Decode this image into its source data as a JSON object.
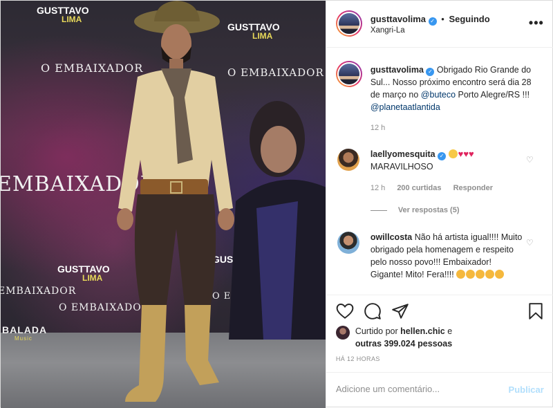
{
  "photo": {
    "alt": "",
    "backdrop_texts": [
      "GUSTTAVO",
      "LIMA",
      "O EMBAIXADOR",
      "EMBAIXADOR",
      "BALADA",
      "Music"
    ]
  },
  "header": {
    "username": "gusttavolima",
    "separator": "•",
    "follow_status": "Seguindo",
    "location": "Xangri-La",
    "more_label": "•••"
  },
  "caption": {
    "username": "gusttavolima",
    "text_1": "Obrigado Rio Grande do Sul... Nosso próximo encontro será dia 28 de março no",
    "mention_1": "@buteco",
    "text_2": "Porto Alegre/RS !!!",
    "mention_2": "@planetaatlantida",
    "age": "12 h"
  },
  "comments": [
    {
      "username": "laellyomesquita",
      "text": "MARAVILHOSO",
      "age": "12 h",
      "likes": "200 curtidas",
      "reply": "Responder",
      "view_replies": "Ver respostas (5)"
    },
    {
      "username": "owillcosta",
      "text": "Não há artista igual!!!! Muito obrigado pela homenagem e respeito pelo nosso povo!!! Embaixador! Gigante! Mito! Fera!!!!"
    }
  ],
  "liked": {
    "prefix": "Curtido por",
    "user": "hellen.chic",
    "conj": "e",
    "others": "outras 399.024 pessoas"
  },
  "time_ago": "HÁ 12 HORAS",
  "add_comment": {
    "placeholder": "Adicione um comentário...",
    "publish": "Publicar"
  },
  "colors": {
    "link": "#00376b",
    "verified": "#3897f0",
    "muted": "#8e8e8e",
    "publish_disabled": "#b2dffc"
  }
}
